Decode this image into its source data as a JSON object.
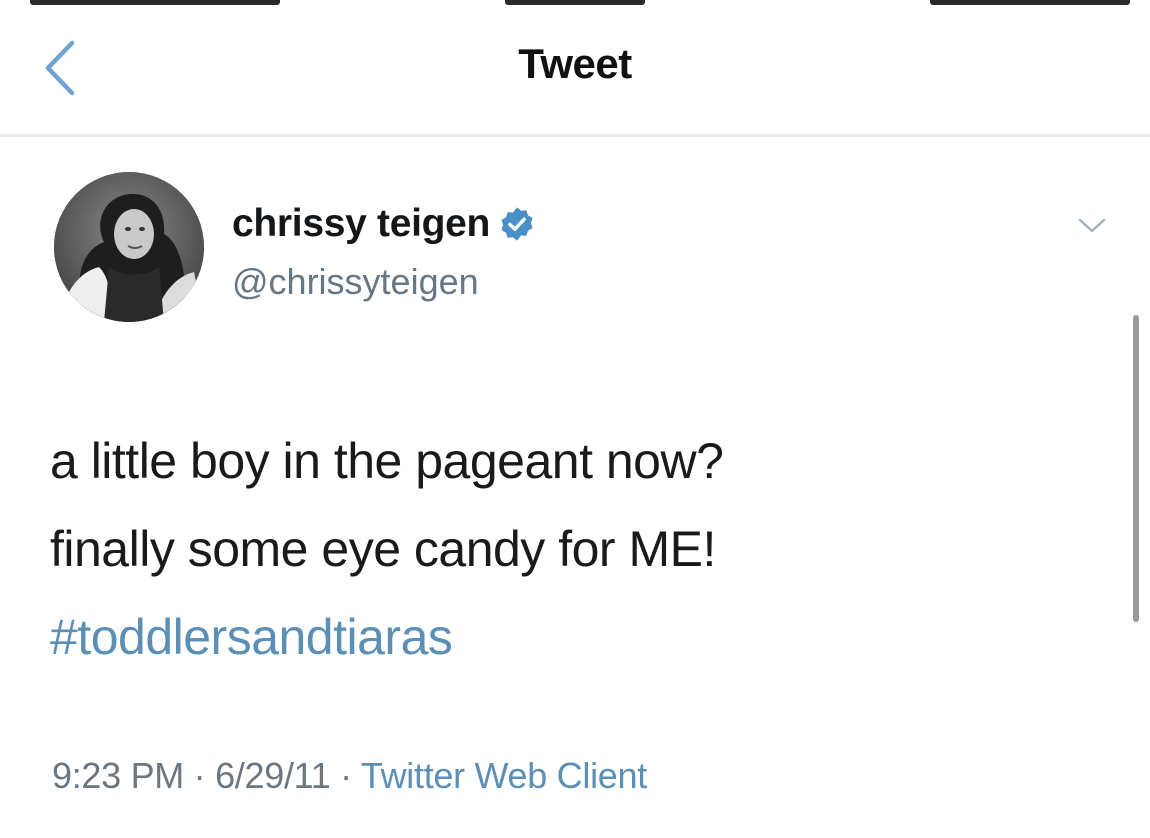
{
  "nav": {
    "title": "Tweet",
    "back_icon": "chevron-left-icon"
  },
  "tweet": {
    "author": {
      "display_name": "chrissy teigen",
      "handle": "@chrissyteigen",
      "verified": true,
      "verified_icon": "verified-badge-icon"
    },
    "text_lines": [
      "a little boy in the pageant now?",
      "finally some eye candy for ME!"
    ],
    "hashtag": "#toddlersandtiaras",
    "time": "9:23 PM",
    "date": "6/29/11",
    "separator": "·",
    "source": "Twitter Web Client",
    "caret_icon": "chevron-down-icon"
  },
  "colors": {
    "link": "#5b8fb5",
    "verified": "#4a90c8",
    "muted": "#657786",
    "divider": "#e6ecf0"
  }
}
